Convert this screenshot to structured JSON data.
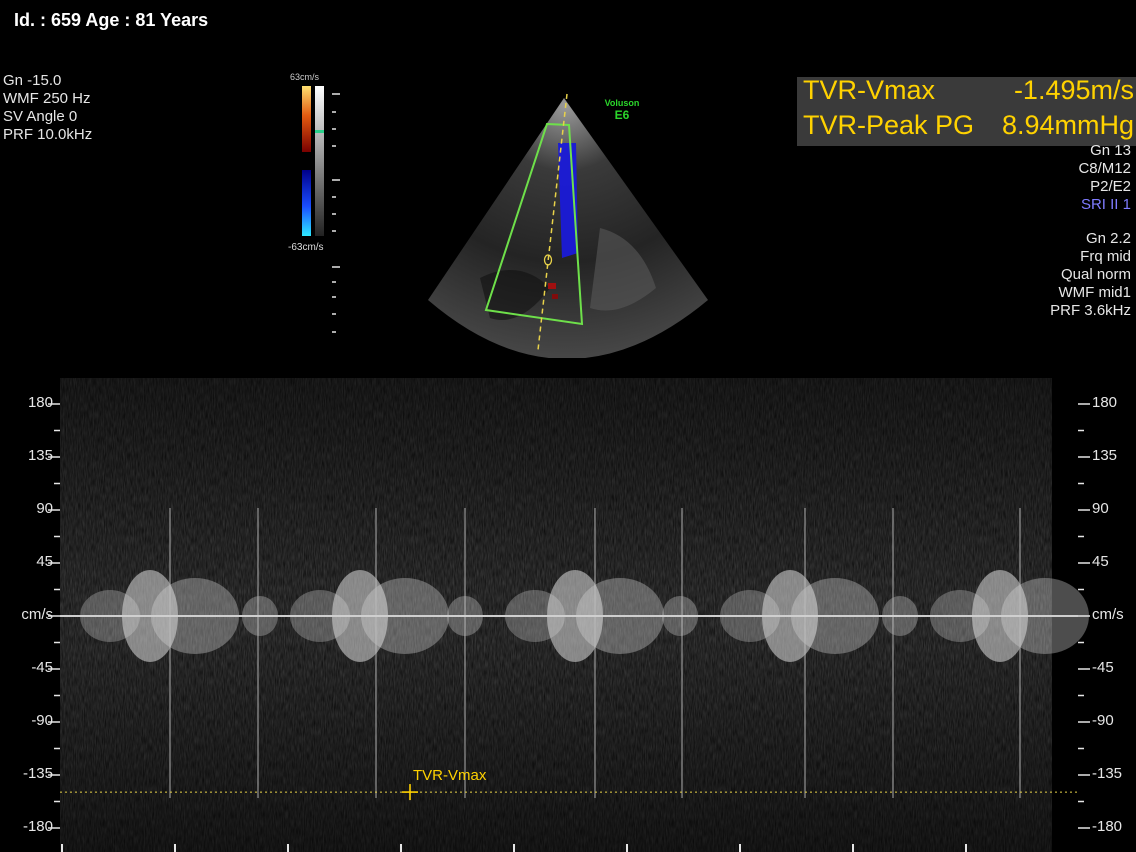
{
  "patient": {
    "text": "Id. : 659 Age : 81 Years"
  },
  "left_params": [
    "Gn -15.0",
    "WMF 250 Hz",
    "SV Angle  0",
    "PRF 10.0kHz"
  ],
  "colorbar": {
    "top_label": "63cm/s",
    "bottom_label": "-63cm/s"
  },
  "logo": {
    "brand": "Voluson",
    "model": "E6"
  },
  "measurements": [
    {
      "name": "TVR-Vmax",
      "value": "-1.495m/s"
    },
    {
      "name": "TVR-Peak PG",
      "value": "8.94mmHg"
    }
  ],
  "right_params_group1": [
    "Gn  13",
    "C8/M12",
    "P2/E2",
    "SRI II 1"
  ],
  "right_params_group2": [
    "Gn  2.2",
    "Frq mid",
    "Qual norm",
    "WMF mid1",
    "PRF  3.6kHz"
  ],
  "spectrum": {
    "axis_unit": "cm/s",
    "ticks": [
      180,
      135,
      90,
      45,
      0,
      -45,
      -90,
      -135,
      -180
    ],
    "tick_labels": [
      "180",
      "135",
      "90",
      "45",
      "cm/s",
      "-45",
      "-90",
      "-135",
      "-180"
    ],
    "marker_label": "TVR-Vmax",
    "marker_value_cm_s": -149.5
  },
  "colors": {
    "measurement": "#ffd200",
    "sample_box": "#6ee04a",
    "sri": "#7f7cff"
  }
}
